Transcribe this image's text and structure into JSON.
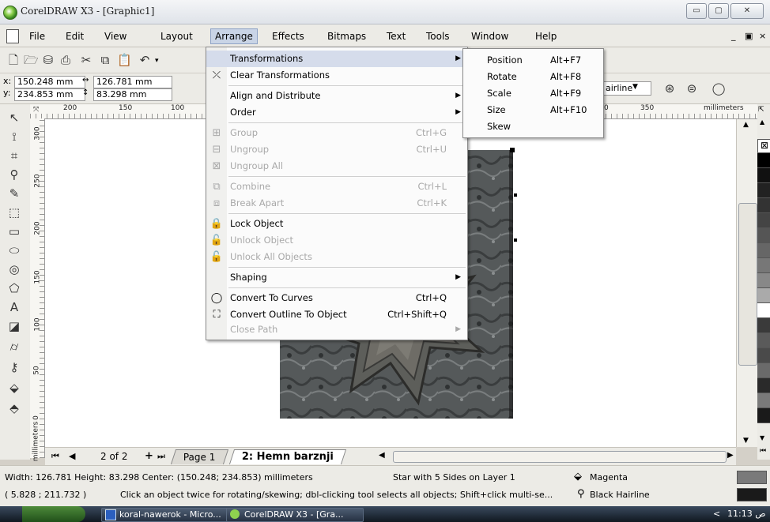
{
  "window": {
    "title": "CorelDRAW X3 - [Graphic1]",
    "controls": [
      "▭",
      "▢",
      "✕"
    ]
  },
  "menubar": {
    "items": [
      "File",
      "Edit",
      "View",
      "Layout",
      "Arrange",
      "Effects",
      "Bitmaps",
      "Text",
      "Tools",
      "Window",
      "Help"
    ],
    "doc_controls": [
      "_",
      "▣",
      "×"
    ]
  },
  "property_bar": {
    "x_label": "x:",
    "y_label": "y:",
    "x_value": "150.248 mm",
    "y_value": "234.853 mm",
    "width_value": "126.781 mm",
    "height_value": "83.298 mm",
    "outline_value": "airline"
  },
  "ruler": {
    "h_ticks": [
      "200",
      "150",
      "100",
      "0",
      "350"
    ],
    "h_unit": "millimeters",
    "v_ticks": [
      "300",
      "250",
      "200",
      "150",
      "100",
      "50",
      "0"
    ],
    "v_unit": "millimeters"
  },
  "arrange_menu": {
    "items": [
      {
        "label": "Transformations",
        "shortcut": "",
        "submenu": true,
        "disabled": false,
        "highlight": true,
        "icon": ""
      },
      {
        "label": "Clear Transformations",
        "shortcut": "",
        "submenu": false,
        "disabled": false,
        "icon": "clear-transform-icon"
      },
      {
        "label": "Align and Distribute",
        "shortcut": "",
        "submenu": true,
        "disabled": false,
        "icon": ""
      },
      {
        "label": "Order",
        "shortcut": "",
        "submenu": true,
        "disabled": false,
        "icon": ""
      },
      {
        "label": "Group",
        "shortcut": "Ctrl+G",
        "submenu": false,
        "disabled": true,
        "icon": "group-icon"
      },
      {
        "label": "Ungroup",
        "shortcut": "Ctrl+U",
        "submenu": false,
        "disabled": true,
        "icon": "ungroup-icon"
      },
      {
        "label": "Ungroup All",
        "shortcut": "",
        "submenu": false,
        "disabled": true,
        "icon": "ungroup-all-icon"
      },
      {
        "label": "Combine",
        "shortcut": "Ctrl+L",
        "submenu": false,
        "disabled": true,
        "icon": "combine-icon"
      },
      {
        "label": "Break Apart",
        "shortcut": "Ctrl+K",
        "submenu": false,
        "disabled": true,
        "icon": "break-apart-icon"
      },
      {
        "label": "Lock Object",
        "shortcut": "",
        "submenu": false,
        "disabled": false,
        "icon": "lock-icon"
      },
      {
        "label": "Unlock Object",
        "shortcut": "",
        "submenu": false,
        "disabled": true,
        "icon": "unlock-icon"
      },
      {
        "label": "Unlock All Objects",
        "shortcut": "",
        "submenu": false,
        "disabled": true,
        "icon": "unlock-all-icon"
      },
      {
        "label": "Shaping",
        "shortcut": "",
        "submenu": true,
        "disabled": false,
        "icon": ""
      },
      {
        "label": "Convert To Curves",
        "shortcut": "Ctrl+Q",
        "submenu": false,
        "disabled": false,
        "icon": "convert-curves-icon"
      },
      {
        "label": "Convert Outline To Object",
        "shortcut": "Ctrl+Shift+Q",
        "submenu": false,
        "disabled": false,
        "icon": "convert-outline-icon"
      },
      {
        "label": "Close Path",
        "shortcut": "",
        "submenu": true,
        "disabled": true,
        "icon": ""
      }
    ]
  },
  "transform_submenu": {
    "items": [
      {
        "label": "Position",
        "shortcut": "Alt+F7"
      },
      {
        "label": "Rotate",
        "shortcut": "Alt+F8"
      },
      {
        "label": "Scale",
        "shortcut": "Alt+F9"
      },
      {
        "label": "Size",
        "shortcut": "Alt+F10"
      },
      {
        "label": "Skew",
        "shortcut": ""
      }
    ]
  },
  "page_nav": {
    "counter": "2 of 2",
    "page1": "Page 1",
    "page2": "2: Hemn barznji"
  },
  "status": {
    "line1_left": "Width: 126.781  Height: 83.298  Center: (150.248; 234.853)  millimeters",
    "line1_mid": "Star with 5 Sides on Layer 1",
    "fill": "Magenta",
    "line2_left": "( 5.828 ; 211.732 )",
    "line2_hint": "Click an object twice for rotating/skewing; dbl-clicking tool selects all objects; Shift+click multi-se...",
    "outline": "Black  Hairline"
  },
  "taskbar": {
    "task1": "koral-nawerok - Micro...",
    "task2": "CorelDRAW X3 - [Gra...",
    "clock": "11:13 ص"
  },
  "colors": {
    "fill_swatch": "#7a7a7a",
    "outline_swatch": "#1a1a1a"
  }
}
